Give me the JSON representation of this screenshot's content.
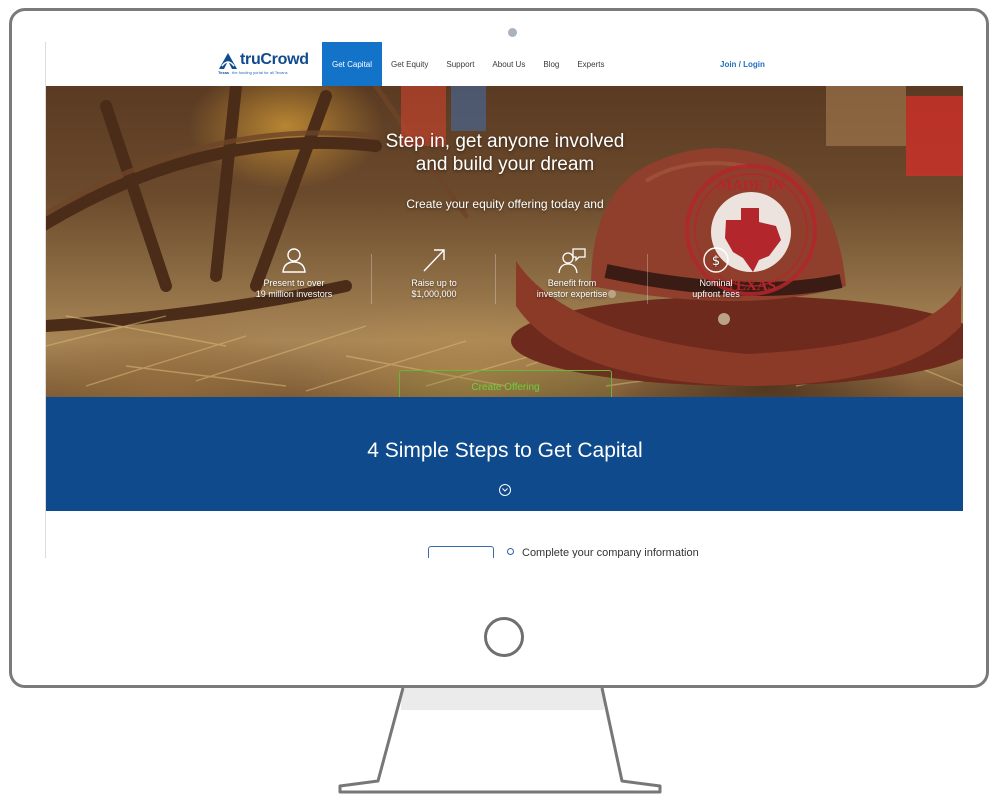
{
  "brand": {
    "name": "truCrowd",
    "state": "Texas",
    "tagline": "the funding portal for all Texans"
  },
  "nav": {
    "items": [
      {
        "label": "Get Capital",
        "active": true
      },
      {
        "label": "Get Equity",
        "active": false
      },
      {
        "label": "Support",
        "active": false
      },
      {
        "label": "About Us",
        "active": false
      },
      {
        "label": "Blog",
        "active": false
      },
      {
        "label": "Experts",
        "active": false
      }
    ],
    "login_label": "Join / Login"
  },
  "hero": {
    "title_lines": [
      "Step in, get anyone involved",
      "and build your dream"
    ],
    "subtitle": "Create your equity offering today and",
    "features": [
      {
        "icon": "person-icon",
        "lines": [
          "Present to over",
          "19 million investors"
        ]
      },
      {
        "icon": "arrow-up-right-icon",
        "lines": [
          "Raise up to",
          "$1,000,000"
        ]
      },
      {
        "icon": "expert-chat-icon",
        "lines": [
          "Benefit from",
          "investor expertise"
        ]
      },
      {
        "icon": "dollar-coin-icon",
        "lines": [
          "Nominal",
          "upfront fees"
        ]
      }
    ],
    "cta_label": "Create Offering",
    "stamp": {
      "top_text": "MADE IN",
      "bottom_text": "TEXAS"
    }
  },
  "steps": {
    "title": "4 Simple Steps to Get Capital",
    "first_step": "Complete your company information"
  },
  "colors": {
    "nav_active": "#1373c8",
    "brand_blue": "#0f4b8f",
    "steps_band": "#0e4a8c",
    "cta_green": "#6bd03e",
    "stamp_red": "#b3262b"
  }
}
